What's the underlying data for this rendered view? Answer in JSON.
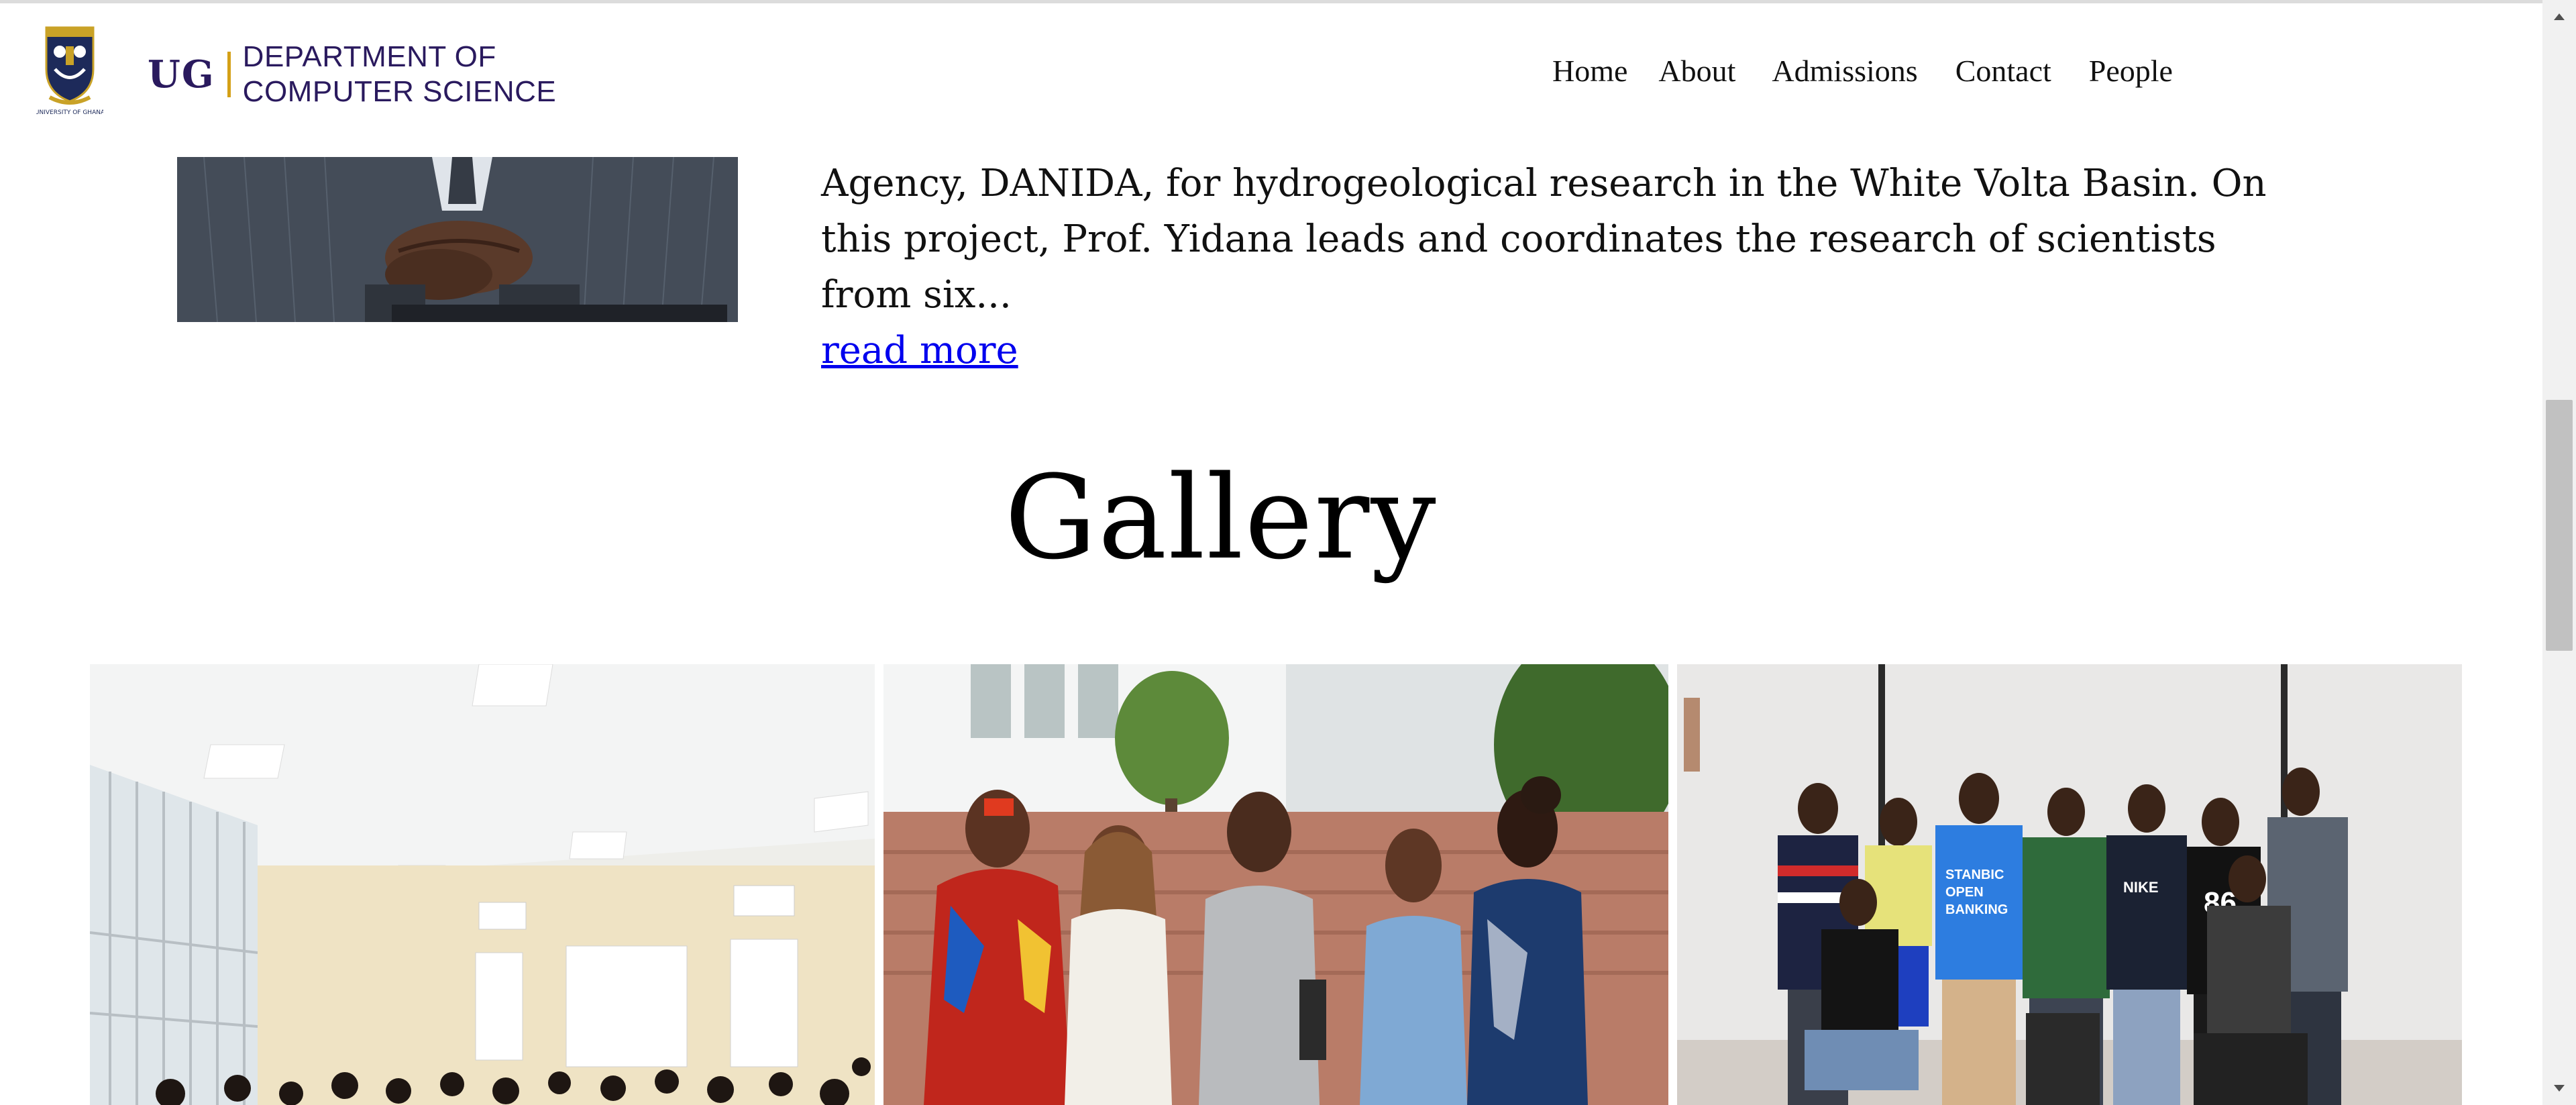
{
  "header": {
    "logo_caption": "UNIVERSITY OF GHANA",
    "brand_abbr": "UG",
    "brand_line1": "DEPARTMENT OF",
    "brand_line2": "COMPUTER SCIENCE"
  },
  "nav": {
    "items": [
      {
        "label": "Home"
      },
      {
        "label": "About"
      },
      {
        "label": "Admissions"
      },
      {
        "label": "Contact"
      },
      {
        "label": "People"
      }
    ]
  },
  "profile": {
    "excerpt": "Agency, DANIDA, for hydrogeological research in the White Volta Basin. On this project, Prof. Yidana leads and coordinates the research of scientists from six...",
    "read_more": "read more"
  },
  "gallery": {
    "title": "Gallery",
    "images": [
      {
        "alt": "lecture hall"
      },
      {
        "alt": "students laughing"
      },
      {
        "alt": "group of students"
      }
    ],
    "shirt_text_1": "STANBIC",
    "shirt_text_2": "OPEN",
    "shirt_text_3": "BANKING",
    "shirt_number": "86",
    "shirt_brand": "NIKE"
  },
  "colors": {
    "brand": "#2a1a5e",
    "accent": "#d4a017",
    "link": "#0000ee"
  }
}
